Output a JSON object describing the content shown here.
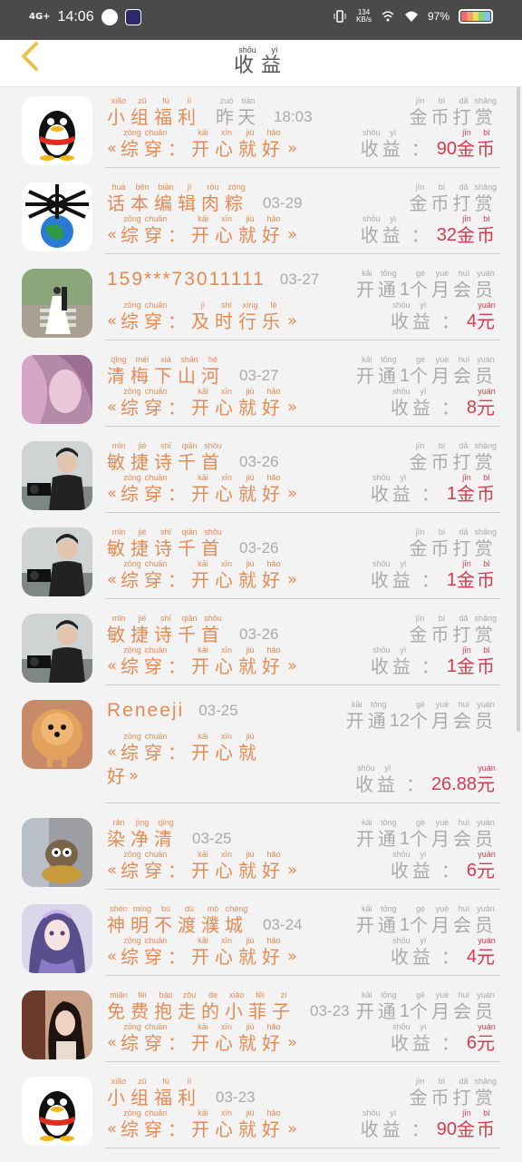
{
  "status": {
    "network": "4G+",
    "time": "14:06",
    "speed_value": "134",
    "speed_unit": "KB/s",
    "battery": "97%"
  },
  "header": {
    "title": [
      {
        "hz": "收",
        "py": "shōu"
      },
      {
        "hz": "益",
        "py": "yì"
      }
    ]
  },
  "rows": [
    {
      "avatar": "qq-penguin-avatar",
      "name": [
        {
          "hz": "小",
          "py": "xiǎo"
        },
        {
          "hz": "组",
          "py": "zǔ"
        },
        {
          "hz": "福",
          "py": "fú"
        },
        {
          "hz": "利",
          "py": "lì"
        }
      ],
      "date_ruby": [
        {
          "hz": "昨",
          "py": "zuó"
        },
        {
          "hz": "天",
          "py": "tiān"
        }
      ],
      "date": "18:03",
      "work": [
        {
          "hz": "综",
          "py": "zōng"
        },
        {
          "hz": "穿",
          "py": "chuān"
        },
        {
          "hz": "：",
          "py": ""
        },
        {
          "hz": "开",
          "py": "kāi"
        },
        {
          "hz": "心",
          "py": "xīn"
        },
        {
          "hz": "就",
          "py": "jiù"
        },
        {
          "hz": "好",
          "py": "hǎo"
        }
      ],
      "action": [
        {
          "hz": "金",
          "py": "jīn"
        },
        {
          "hz": "币",
          "py": "bì"
        },
        {
          "hz": "打",
          "py": "dǎ"
        },
        {
          "hz": "赏",
          "py": "shǎng"
        }
      ],
      "income": [
        {
          "hz": "收",
          "py": "shōu"
        },
        {
          "hz": "益",
          "py": "yì"
        }
      ],
      "amount": "90",
      "unit": [
        {
          "hz": "金",
          "py": "jīn"
        },
        {
          "hz": "币",
          "py": "bì"
        }
      ]
    },
    {
      "avatar": "skeleton-globe-avatar",
      "name": [
        {
          "hz": "话",
          "py": "huà"
        },
        {
          "hz": "本",
          "py": "běn"
        },
        {
          "hz": "编",
          "py": "biān"
        },
        {
          "hz": "辑",
          "py": "jí"
        },
        {
          "hz": "肉",
          "py": "ròu"
        },
        {
          "hz": "粽",
          "py": "zòng"
        }
      ],
      "date": "03-29",
      "work": [
        {
          "hz": "综",
          "py": "zōng"
        },
        {
          "hz": "穿",
          "py": "chuān"
        },
        {
          "hz": "：",
          "py": ""
        },
        {
          "hz": "开",
          "py": "kāi"
        },
        {
          "hz": "心",
          "py": "xīn"
        },
        {
          "hz": "就",
          "py": "jiù"
        },
        {
          "hz": "好",
          "py": "hǎo"
        }
      ],
      "action": [
        {
          "hz": "金",
          "py": "jīn"
        },
        {
          "hz": "币",
          "py": "bì"
        },
        {
          "hz": "打",
          "py": "dǎ"
        },
        {
          "hz": "赏",
          "py": "shǎng"
        }
      ],
      "income": [
        {
          "hz": "收",
          "py": "shōu"
        },
        {
          "hz": "益",
          "py": "yì"
        }
      ],
      "amount": "32",
      "unit": [
        {
          "hz": "金",
          "py": "jīn"
        },
        {
          "hz": "币",
          "py": "bì"
        }
      ]
    },
    {
      "avatar": "wedding-photo-avatar",
      "name_plain": "159***73011111",
      "date": "03-27",
      "work": [
        {
          "hz": "综",
          "py": "zōng"
        },
        {
          "hz": "穿",
          "py": "chuān"
        },
        {
          "hz": "：",
          "py": ""
        },
        {
          "hz": "及",
          "py": "jí"
        },
        {
          "hz": "时",
          "py": "shí"
        },
        {
          "hz": "行",
          "py": "xíng"
        },
        {
          "hz": "乐",
          "py": "lè"
        }
      ],
      "action_pre": [
        {
          "hz": "开",
          "py": "kāi"
        },
        {
          "hz": "通",
          "py": "tōng"
        }
      ],
      "action_num": "1",
      "action_post": [
        {
          "hz": "个",
          "py": "gè"
        },
        {
          "hz": "月",
          "py": "yuè"
        },
        {
          "hz": "会",
          "py": "huì"
        },
        {
          "hz": "员",
          "py": "yuán"
        }
      ],
      "income": [
        {
          "hz": "收",
          "py": "shōu"
        },
        {
          "hz": "益",
          "py": "yì"
        }
      ],
      "amount": "4",
      "unit": [
        {
          "hz": "元",
          "py": "yuán"
        }
      ]
    },
    {
      "avatar": "pink-anime-avatar",
      "name": [
        {
          "hz": "清",
          "py": "qīng"
        },
        {
          "hz": "梅",
          "py": "méi"
        },
        {
          "hz": "下",
          "py": "xià"
        },
        {
          "hz": "山",
          "py": "shān"
        },
        {
          "hz": "河",
          "py": "hé"
        }
      ],
      "date": "03-27",
      "work": [
        {
          "hz": "综",
          "py": "zōng"
        },
        {
          "hz": "穿",
          "py": "chuān"
        },
        {
          "hz": "：",
          "py": ""
        },
        {
          "hz": "开",
          "py": "kāi"
        },
        {
          "hz": "心",
          "py": "xīn"
        },
        {
          "hz": "就",
          "py": "jiù"
        },
        {
          "hz": "好",
          "py": "hǎo"
        }
      ],
      "action_pre": [
        {
          "hz": "开",
          "py": "kāi"
        },
        {
          "hz": "通",
          "py": "tōng"
        }
      ],
      "action_num": "1",
      "action_post": [
        {
          "hz": "个",
          "py": "gè"
        },
        {
          "hz": "月",
          "py": "yuè"
        },
        {
          "hz": "会",
          "py": "huì"
        },
        {
          "hz": "员",
          "py": "yuán"
        }
      ],
      "income": [
        {
          "hz": "收",
          "py": "shōu"
        },
        {
          "hz": "益",
          "py": "yì"
        }
      ],
      "amount": "8",
      "unit": [
        {
          "hz": "元",
          "py": "yuán"
        }
      ]
    },
    {
      "avatar": "man-camera-avatar",
      "name": [
        {
          "hz": "敏",
          "py": "mǐn"
        },
        {
          "hz": "捷",
          "py": "jié"
        },
        {
          "hz": "诗",
          "py": "shī"
        },
        {
          "hz": "千",
          "py": "qiān"
        },
        {
          "hz": "首",
          "py": "shǒu"
        }
      ],
      "date": "03-26",
      "work": [
        {
          "hz": "综",
          "py": "zōng"
        },
        {
          "hz": "穿",
          "py": "chuān"
        },
        {
          "hz": "：",
          "py": ""
        },
        {
          "hz": "开",
          "py": "kāi"
        },
        {
          "hz": "心",
          "py": "xīn"
        },
        {
          "hz": "就",
          "py": "jiù"
        },
        {
          "hz": "好",
          "py": "hǎo"
        }
      ],
      "action": [
        {
          "hz": "金",
          "py": "jīn"
        },
        {
          "hz": "币",
          "py": "bì"
        },
        {
          "hz": "打",
          "py": "dǎ"
        },
        {
          "hz": "赏",
          "py": "shǎng"
        }
      ],
      "income": [
        {
          "hz": "收",
          "py": "shōu"
        },
        {
          "hz": "益",
          "py": "yì"
        }
      ],
      "amount": "1",
      "unit": [
        {
          "hz": "金",
          "py": "jīn"
        },
        {
          "hz": "币",
          "py": "bì"
        }
      ]
    },
    {
      "avatar": "man-camera-avatar",
      "name": [
        {
          "hz": "敏",
          "py": "mǐn"
        },
        {
          "hz": "捷",
          "py": "jié"
        },
        {
          "hz": "诗",
          "py": "shī"
        },
        {
          "hz": "千",
          "py": "qiān"
        },
        {
          "hz": "首",
          "py": "shǒu"
        }
      ],
      "date": "03-26",
      "work": [
        {
          "hz": "综",
          "py": "zōng"
        },
        {
          "hz": "穿",
          "py": "chuān"
        },
        {
          "hz": "：",
          "py": ""
        },
        {
          "hz": "开",
          "py": "kāi"
        },
        {
          "hz": "心",
          "py": "xīn"
        },
        {
          "hz": "就",
          "py": "jiù"
        },
        {
          "hz": "好",
          "py": "hǎo"
        }
      ],
      "action": [
        {
          "hz": "金",
          "py": "jīn"
        },
        {
          "hz": "币",
          "py": "bì"
        },
        {
          "hz": "打",
          "py": "dǎ"
        },
        {
          "hz": "赏",
          "py": "shǎng"
        }
      ],
      "income": [
        {
          "hz": "收",
          "py": "shōu"
        },
        {
          "hz": "益",
          "py": "yì"
        }
      ],
      "amount": "1",
      "unit": [
        {
          "hz": "金",
          "py": "jīn"
        },
        {
          "hz": "币",
          "py": "bì"
        }
      ]
    },
    {
      "avatar": "man-camera-avatar",
      "name": [
        {
          "hz": "敏",
          "py": "mǐn"
        },
        {
          "hz": "捷",
          "py": "jié"
        },
        {
          "hz": "诗",
          "py": "shī"
        },
        {
          "hz": "千",
          "py": "qiān"
        },
        {
          "hz": "首",
          "py": "shǒu"
        }
      ],
      "date": "03-26",
      "work": [
        {
          "hz": "综",
          "py": "zōng"
        },
        {
          "hz": "穿",
          "py": "chuān"
        },
        {
          "hz": "：",
          "py": ""
        },
        {
          "hz": "开",
          "py": "kāi"
        },
        {
          "hz": "心",
          "py": "xīn"
        },
        {
          "hz": "就",
          "py": "jiù"
        },
        {
          "hz": "好",
          "py": "hǎo"
        }
      ],
      "action": [
        {
          "hz": "金",
          "py": "jīn"
        },
        {
          "hz": "币",
          "py": "bì"
        },
        {
          "hz": "打",
          "py": "dǎ"
        },
        {
          "hz": "赏",
          "py": "shǎng"
        }
      ],
      "income": [
        {
          "hz": "收",
          "py": "shōu"
        },
        {
          "hz": "益",
          "py": "yì"
        }
      ],
      "amount": "1",
      "unit": [
        {
          "hz": "金",
          "py": "jīn"
        },
        {
          "hz": "币",
          "py": "bì"
        }
      ]
    },
    {
      "avatar": "pomeranian-dog-avatar",
      "name_plain": "Reneeji",
      "date": "03-25",
      "work": [
        {
          "hz": "综",
          "py": "zōng"
        },
        {
          "hz": "穿",
          "py": "chuān"
        },
        {
          "hz": "：",
          "py": ""
        },
        {
          "hz": "开",
          "py": "kāi"
        },
        {
          "hz": "心",
          "py": "xīn"
        },
        {
          "hz": "就",
          "py": "jiù"
        }
      ],
      "work_wrap": [
        {
          "hz": "好",
          "py": ""
        }
      ],
      "action_pre": [
        {
          "hz": "开",
          "py": "kāi"
        },
        {
          "hz": "通",
          "py": "tōng"
        }
      ],
      "action_num": "12",
      "action_post": [
        {
          "hz": "个",
          "py": "gè"
        },
        {
          "hz": "月",
          "py": "yuè"
        },
        {
          "hz": "会",
          "py": "huì"
        },
        {
          "hz": "员",
          "py": "yuán"
        }
      ],
      "income": [
        {
          "hz": "收",
          "py": "shōu"
        },
        {
          "hz": "益",
          "py": "yì"
        }
      ],
      "amount": "26.88",
      "unit": [
        {
          "hz": "元",
          "py": "yuán"
        }
      ]
    },
    {
      "avatar": "plush-toy-avatar",
      "name": [
        {
          "hz": "染",
          "py": "rǎn"
        },
        {
          "hz": "净",
          "py": "jìng"
        },
        {
          "hz": "清",
          "py": "qīng"
        }
      ],
      "date": "03-25",
      "work": [
        {
          "hz": "综",
          "py": "zōng"
        },
        {
          "hz": "穿",
          "py": "chuān"
        },
        {
          "hz": "：",
          "py": ""
        },
        {
          "hz": "开",
          "py": "kāi"
        },
        {
          "hz": "心",
          "py": "xīn"
        },
        {
          "hz": "就",
          "py": "jiù"
        },
        {
          "hz": "好",
          "py": "hǎo"
        }
      ],
      "action_pre": [
        {
          "hz": "开",
          "py": "kāi"
        },
        {
          "hz": "通",
          "py": "tōng"
        }
      ],
      "action_num": "1",
      "action_post": [
        {
          "hz": "个",
          "py": "gè"
        },
        {
          "hz": "月",
          "py": "yuè"
        },
        {
          "hz": "会",
          "py": "huì"
        },
        {
          "hz": "员",
          "py": "yuán"
        }
      ],
      "income": [
        {
          "hz": "收",
          "py": "shōu"
        },
        {
          "hz": "益",
          "py": "yì"
        }
      ],
      "amount": "6",
      "unit": [
        {
          "hz": "元",
          "py": "yuán"
        }
      ]
    },
    {
      "avatar": "purple-anime-avatar",
      "name": [
        {
          "hz": "神",
          "py": "shén"
        },
        {
          "hz": "明",
          "py": "míng"
        },
        {
          "hz": "不",
          "py": "bù"
        },
        {
          "hz": "渡",
          "py": "dù"
        },
        {
          "hz": "濮",
          "py": "mò"
        },
        {
          "hz": "城",
          "py": "chéng"
        }
      ],
      "date": "03-24",
      "work": [
        {
          "hz": "综",
          "py": "zōng"
        },
        {
          "hz": "穿",
          "py": "chuān"
        },
        {
          "hz": "：",
          "py": ""
        },
        {
          "hz": "开",
          "py": "kāi"
        },
        {
          "hz": "心",
          "py": "xīn"
        },
        {
          "hz": "就",
          "py": "jiù"
        },
        {
          "hz": "好",
          "py": "hǎo"
        }
      ],
      "action_pre": [
        {
          "hz": "开",
          "py": "kāi"
        },
        {
          "hz": "通",
          "py": "tōng"
        }
      ],
      "action_num": "1",
      "action_post": [
        {
          "hz": "个",
          "py": "gè"
        },
        {
          "hz": "月",
          "py": "yuè"
        },
        {
          "hz": "会",
          "py": "huì"
        },
        {
          "hz": "员",
          "py": "yuán"
        }
      ],
      "income": [
        {
          "hz": "收",
          "py": "shōu"
        },
        {
          "hz": "益",
          "py": "yì"
        }
      ],
      "amount": "4",
      "unit": [
        {
          "hz": "元",
          "py": "yuán"
        }
      ]
    },
    {
      "avatar": "girl-photo-avatar",
      "name": [
        {
          "hz": "免",
          "py": "miǎn"
        },
        {
          "hz": "费",
          "py": "fèi"
        },
        {
          "hz": "抱",
          "py": "bào"
        },
        {
          "hz": "走",
          "py": "zǒu"
        },
        {
          "hz": "的",
          "py": "de"
        },
        {
          "hz": "小",
          "py": "xiǎo"
        },
        {
          "hz": "菲",
          "py": "fēi"
        },
        {
          "hz": "子",
          "py": "zi"
        }
      ],
      "date": "03-23",
      "work": [
        {
          "hz": "综",
          "py": "zōng"
        },
        {
          "hz": "穿",
          "py": "chuān"
        },
        {
          "hz": "：",
          "py": ""
        },
        {
          "hz": "开",
          "py": "kāi"
        },
        {
          "hz": "心",
          "py": "xīn"
        },
        {
          "hz": "就",
          "py": "jiù"
        },
        {
          "hz": "好",
          "py": "hǎo"
        }
      ],
      "action_pre": [
        {
          "hz": "开",
          "py": "kāi"
        },
        {
          "hz": "通",
          "py": "tōng"
        }
      ],
      "action_num": "1",
      "action_post": [
        {
          "hz": "个",
          "py": "gè"
        },
        {
          "hz": "月",
          "py": "yuè"
        },
        {
          "hz": "会",
          "py": "huì"
        },
        {
          "hz": "员",
          "py": "yuán"
        }
      ],
      "income": [
        {
          "hz": "收",
          "py": "shōu"
        },
        {
          "hz": "益",
          "py": "yì"
        }
      ],
      "amount": "6",
      "unit": [
        {
          "hz": "元",
          "py": "yuán"
        }
      ]
    },
    {
      "avatar": "qq-penguin-avatar",
      "name": [
        {
          "hz": "小",
          "py": "xiǎo"
        },
        {
          "hz": "组",
          "py": "zǔ"
        },
        {
          "hz": "福",
          "py": "fú"
        },
        {
          "hz": "利",
          "py": "lì"
        }
      ],
      "date": "03-23",
      "work": [
        {
          "hz": "综",
          "py": "zōng"
        },
        {
          "hz": "穿",
          "py": "chuān"
        },
        {
          "hz": "：",
          "py": ""
        },
        {
          "hz": "开",
          "py": "kāi"
        },
        {
          "hz": "心",
          "py": "xīn"
        },
        {
          "hz": "就",
          "py": "jiù"
        },
        {
          "hz": "好",
          "py": "hǎo"
        }
      ],
      "action": [
        {
          "hz": "金",
          "py": "jīn"
        },
        {
          "hz": "币",
          "py": "bì"
        },
        {
          "hz": "打",
          "py": "dǎ"
        },
        {
          "hz": "赏",
          "py": "shǎng"
        }
      ],
      "income": [
        {
          "hz": "收",
          "py": "shōu"
        },
        {
          "hz": "益",
          "py": "yì"
        }
      ],
      "amount": "90",
      "unit": [
        {
          "hz": "金",
          "py": "jīn"
        },
        {
          "hz": "币",
          "py": "bì"
        }
      ]
    }
  ],
  "brackets": {
    "open": "«",
    "close": "»"
  },
  "colors": {
    "accent": "#e58a52",
    "amount": "#d8394e",
    "muted": "#aaaaaa"
  }
}
